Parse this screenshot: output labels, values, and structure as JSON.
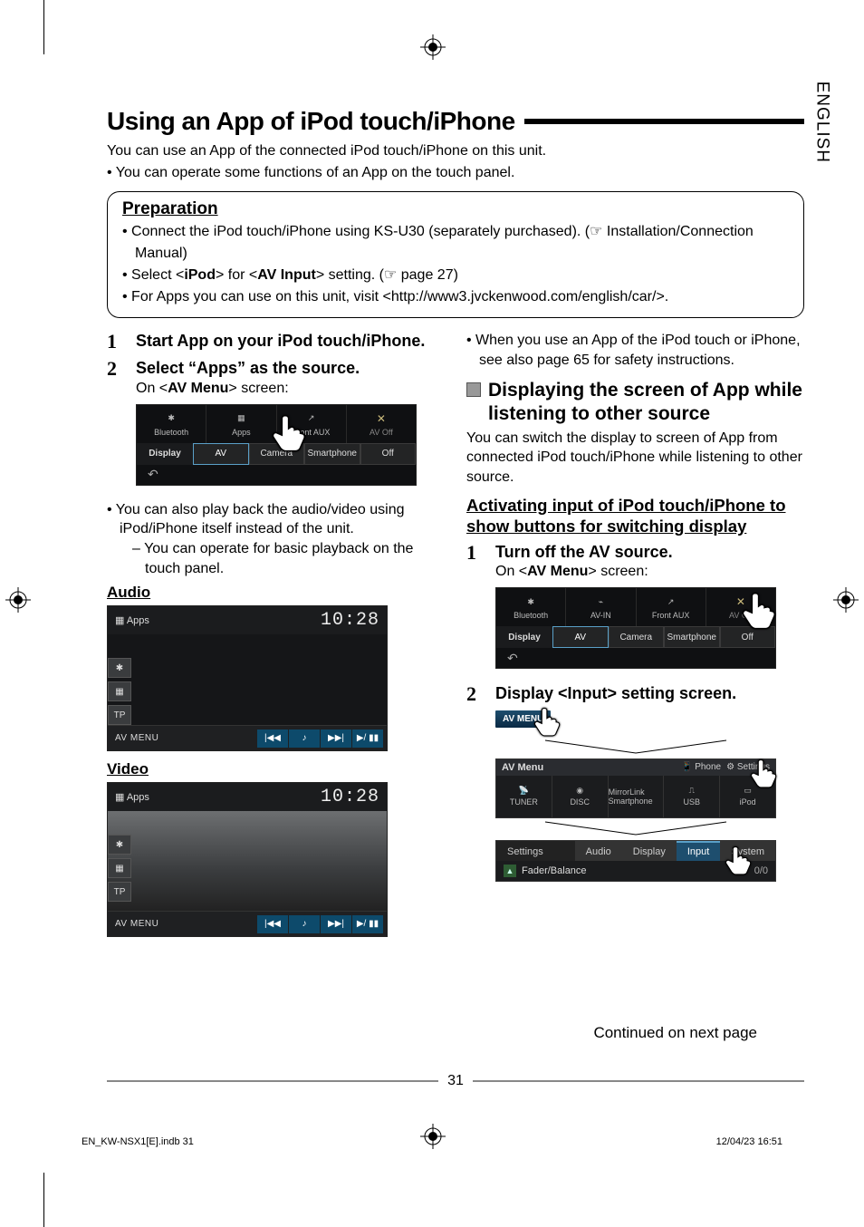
{
  "lang_tab": "ENGLISH",
  "title": "Using an App of iPod touch/iPhone",
  "intro_line": "You can use an App of the connected iPod touch/iPhone on this unit.",
  "intro_bullet": "You can operate some functions of an App on the touch panel.",
  "prep": {
    "heading": "Preparation",
    "b1_a": "Connect the iPod touch/iPhone using KS-U30 (separately purchased). (",
    "b1_icon": "☞",
    "b1_b": " Installation/Connection Manual)",
    "b2_a": "Select <",
    "b2_ip": "iPod",
    "b2_b": "> for <",
    "b2_av": "AV Input",
    "b2_c": "> setting. (",
    "b2_icon": "☞",
    "b2_d": " page 27)",
    "b3": "For Apps you can use on this unit, visit <http://www3.jvckenwood.com/english/car/>."
  },
  "left": {
    "s1": {
      "num": "1",
      "title": "Start App on your iPod touch/iPhone."
    },
    "s2": {
      "num": "2",
      "title": "Select “Apps” as the source.",
      "sub_a": "On <",
      "sub_b": "AV Menu",
      "sub_c": "> screen:"
    },
    "bullet1": "You can also play back the audio/video using iPod/iPhone itself instead of the unit.",
    "bullet1_sub": "You can operate for basic playback on the touch panel.",
    "audio_label": "Audio",
    "video_label": "Video"
  },
  "right": {
    "top_bullet": "When you use an App of the iPod touch or iPhone, see also page 65 for safety instructions.",
    "sec_title": "Displaying the screen of App while listening to other source",
    "sec_body": "You can switch the display to screen of App from connected iPod touch/iPhone while listening to other source.",
    "activate_head": "Activating input of iPod touch/iPhone to show buttons for switching display",
    "s1": {
      "num": "1",
      "title": "Turn off the AV source.",
      "sub_a": "On <",
      "sub_b": "AV Menu",
      "sub_c": "> screen:"
    },
    "s2": {
      "num": "2",
      "title": "Display <Input> setting screen."
    }
  },
  "device1": {
    "tabs": [
      "Bluetooth",
      "Apps",
      "Front AUX",
      "AV Off"
    ],
    "row_label": "Display",
    "pills": [
      "AV",
      "Camera",
      "Smartphone",
      "Off"
    ]
  },
  "device2": {
    "tabs": [
      "Bluetooth",
      "AV-IN",
      "Front AUX",
      "AV Off"
    ],
    "row_label": "Display",
    "pills": [
      "AV",
      "Camera",
      "Smartphone",
      "Off"
    ]
  },
  "player": {
    "source": "Apps",
    "clock": "10:28",
    "tp": "TP",
    "avmenu": "AV MENU",
    "ctrls": [
      "|◀◀",
      "♪",
      "▶▶|",
      "▶/ ▮▮"
    ]
  },
  "stage": {
    "chip": "AV MENU",
    "panel1": {
      "title": "AV Menu",
      "right": [
        "Phone",
        "Settings"
      ],
      "cells": [
        "TUNER",
        "DISC",
        "MirrorLink Smartphone",
        "USB",
        "iPod"
      ]
    },
    "panel2": {
      "title": "Settings",
      "tabs": [
        "Audio",
        "Display",
        "Input",
        "System"
      ],
      "row_label": "Fader/Balance",
      "row_val": "0/0"
    }
  },
  "continued": "Continued on next page",
  "page_num": "31",
  "footer_left": "EN_KW-NSX1[E].indb   31",
  "footer_right": "12/04/23   16:51"
}
